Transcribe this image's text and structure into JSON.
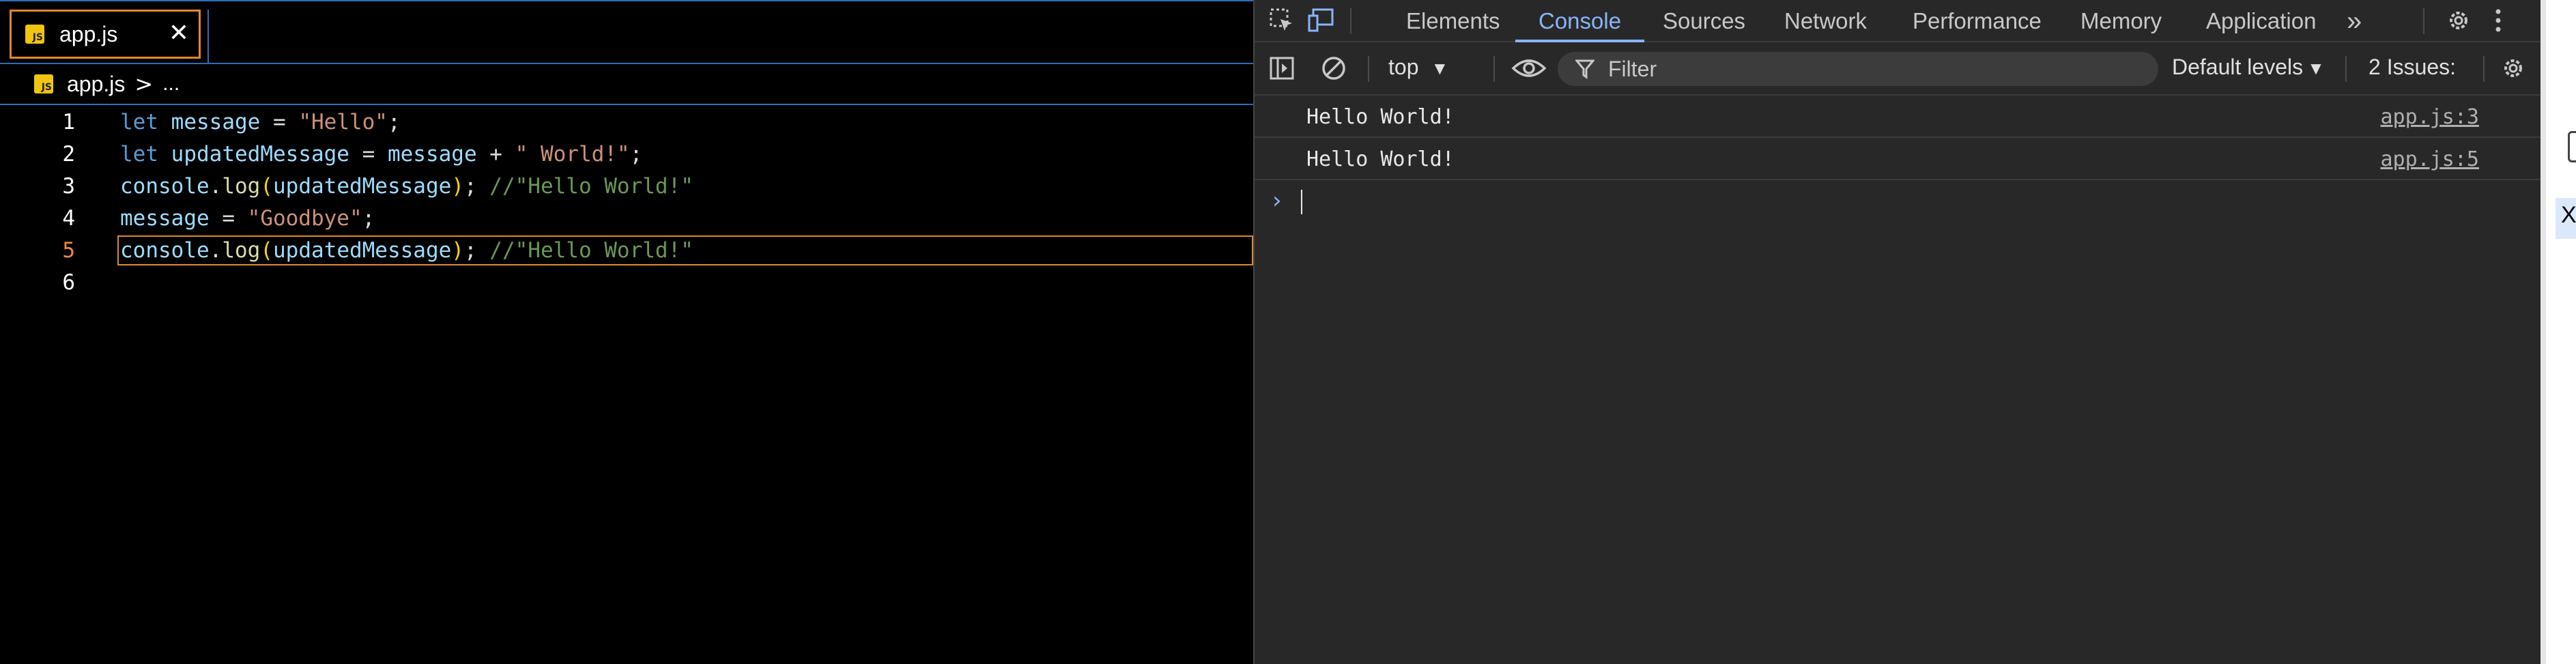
{
  "editor": {
    "tab": {
      "label": "app.js",
      "badge": "JS"
    },
    "breadcrumb": {
      "file": "app.js",
      "separator": ">",
      "more": "..."
    },
    "lines": [
      {
        "num": "1",
        "tokens": [
          {
            "t": "let",
            "c": "kw"
          },
          {
            "t": " ",
            "c": "pn"
          },
          {
            "t": "message",
            "c": "id"
          },
          {
            "t": " = ",
            "c": "pn"
          },
          {
            "t": "\"Hello\"",
            "c": "str"
          },
          {
            "t": ";",
            "c": "pn"
          }
        ]
      },
      {
        "num": "2",
        "tokens": [
          {
            "t": "let",
            "c": "kw"
          },
          {
            "t": " ",
            "c": "pn"
          },
          {
            "t": "updatedMessage",
            "c": "id"
          },
          {
            "t": " = ",
            "c": "pn"
          },
          {
            "t": "message",
            "c": "id"
          },
          {
            "t": " + ",
            "c": "pn"
          },
          {
            "t": "\" World!\"",
            "c": "str"
          },
          {
            "t": ";",
            "c": "pn"
          }
        ]
      },
      {
        "num": "3",
        "tokens": [
          {
            "t": "console",
            "c": "id"
          },
          {
            "t": ".",
            "c": "pn"
          },
          {
            "t": "log",
            "c": "fn"
          },
          {
            "t": "(",
            "c": "paren"
          },
          {
            "t": "updatedMessage",
            "c": "id"
          },
          {
            "t": ")",
            "c": "paren"
          },
          {
            "t": "; ",
            "c": "pn"
          },
          {
            "t": "//\"Hello World!\"",
            "c": "cm"
          }
        ]
      },
      {
        "num": "4",
        "tokens": [
          {
            "t": "message",
            "c": "id"
          },
          {
            "t": " = ",
            "c": "pn"
          },
          {
            "t": "\"Goodbye\"",
            "c": "str"
          },
          {
            "t": ";",
            "c": "pn"
          }
        ]
      },
      {
        "num": "5",
        "current": true,
        "tokens": [
          {
            "t": "console",
            "c": "id"
          },
          {
            "t": ".",
            "c": "pn"
          },
          {
            "t": "log",
            "c": "fn"
          },
          {
            "t": "(",
            "c": "paren"
          },
          {
            "t": "updatedMessage",
            "c": "id"
          },
          {
            "t": ")",
            "c": "paren"
          },
          {
            "t": "; ",
            "c": "pn"
          },
          {
            "t": "//\"Hello World!\"",
            "c": "cm"
          }
        ]
      },
      {
        "num": "6",
        "tokens": []
      }
    ]
  },
  "devtools": {
    "tabs": [
      "Elements",
      "Console",
      "Sources",
      "Network",
      "Performance",
      "Memory",
      "Application"
    ],
    "active_tab": "Console",
    "more_tabs": "»",
    "context": "top",
    "filter_placeholder": "Filter",
    "levels": "Default levels",
    "issues": "2 Issues:",
    "messages": [
      {
        "text": "Hello World!",
        "source": "app.js:3"
      },
      {
        "text": "Hello World!",
        "source": "app.js:5"
      }
    ],
    "prompt_caret": "›"
  },
  "strip": {
    "close": "X"
  },
  "colors": {
    "accent": "#8ab4f8",
    "focus_border": "#e0882c",
    "editor_divider": "#2b6eb8",
    "devtools_bg": "#282828"
  }
}
